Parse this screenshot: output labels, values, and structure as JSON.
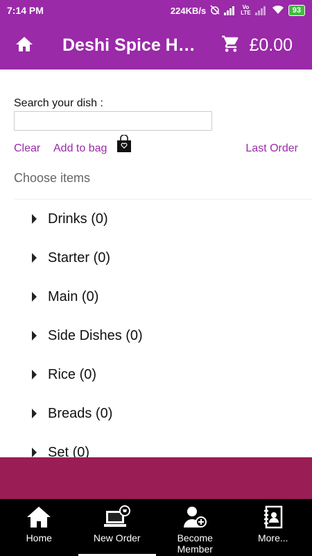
{
  "status_bar": {
    "time": "7:14 PM",
    "speed": "224KB/s",
    "network_label": "Vo\nLTE",
    "battery": "93"
  },
  "app_bar": {
    "title": "Deshi Spice He…",
    "cart_total": "£0.00"
  },
  "search": {
    "label": "Search your dish :",
    "value": "",
    "placeholder": ""
  },
  "actions": {
    "clear": "Clear",
    "add_to_bag": "Add to bag",
    "last_order": "Last Order"
  },
  "choose_items": "Choose items",
  "menu": [
    {
      "label": "Drinks (0)"
    },
    {
      "label": "Starter (0)"
    },
    {
      "label": "Main (0)"
    },
    {
      "label": "Side Dishes (0)"
    },
    {
      "label": "Rice (0)"
    },
    {
      "label": "Breads (0)"
    },
    {
      "label": "Set (0)"
    }
  ],
  "bottom_nav": [
    {
      "label": "Home",
      "icon": "home-icon"
    },
    {
      "label": "New Order",
      "icon": "new-order-icon",
      "selected": true
    },
    {
      "label": "Become\nMember",
      "icon": "add-member-icon"
    },
    {
      "label": "More...",
      "icon": "contacts-book-icon"
    }
  ],
  "colors": {
    "primary": "#9a2aa8",
    "band": "#9a1d55",
    "nav_bg": "#000000",
    "link": "#9a2aa8"
  }
}
